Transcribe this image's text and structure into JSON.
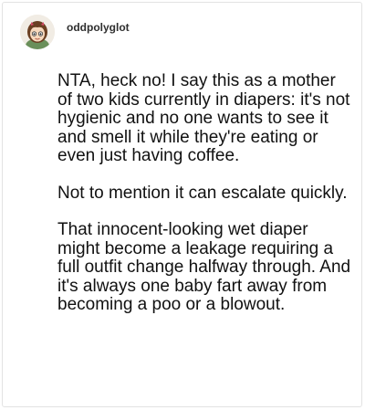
{
  "post": {
    "author": "oddpolyglot",
    "avatar_icon": "cartoon-girl-avatar-icon",
    "paragraphs": [
      "NTA, heck no! I say this as a mother of two kids currently in diapers: it's not hygienic and no one wants to see it and smell it while they're eating or even just having coffee.",
      "Not to mention it can escalate quickly.",
      "That innocent-looking wet diaper might become a leakage requiring a full outfit change halfway through. And it's always one baby fart away from becoming a poo or a blowout."
    ]
  }
}
